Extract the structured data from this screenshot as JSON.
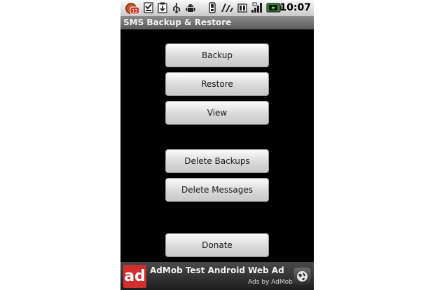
{
  "status_bar": {
    "notification_count": "12",
    "time": "10:07"
  },
  "app_title": "SMS Backup & Restore",
  "buttons": {
    "backup": "Backup",
    "restore": "Restore",
    "view": "View",
    "delete_backups": "Delete Backups",
    "delete_messages": "Delete Messages",
    "donate": "Donate"
  },
  "ad": {
    "logo": "ad",
    "text": "AdMob Test Android Web Ad",
    "caption": "Ads by AdMob",
    "icon": "globe-icon"
  },
  "colors": {
    "screen_background": "#000000",
    "title_bar": "#6e6e6e",
    "ad_logo": "#d12e2e",
    "battery_accent": "#2f8f2f"
  }
}
